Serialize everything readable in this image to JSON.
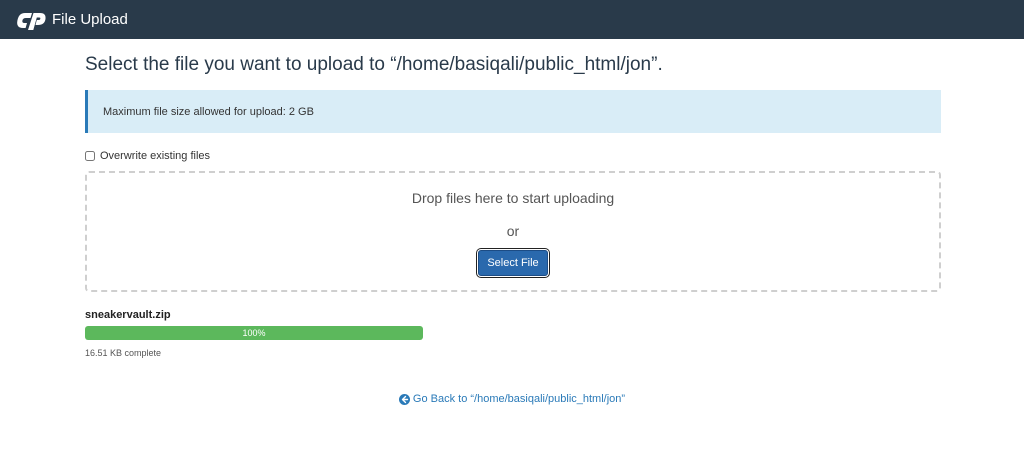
{
  "header": {
    "app_title": "File Upload",
    "logo_name": "cpanel-logo"
  },
  "main": {
    "title": "Select the file you want to upload to “/home/basiqali/public_html/jon”.",
    "info_message": "Maximum file size allowed for upload: 2 GB",
    "overwrite_label": "Overwrite existing files",
    "overwrite_checked": false,
    "dropzone": {
      "drop_text": "Drop files here to start uploading",
      "or_text": "or",
      "select_button_label": "Select File"
    },
    "upload": {
      "file_name": "sneakervault.zip",
      "progress_percent": 100,
      "progress_label": "100%",
      "status_text": "16.51 KB complete"
    },
    "go_back_label": "Go Back to “/home/basiqali/public_html/jon”"
  },
  "colors": {
    "header_bg": "#293a4a",
    "info_bg": "#d9edf7",
    "info_border": "#2a7ab8",
    "button_bg": "#2a69ad",
    "progress_fill": "#5cb85c",
    "link": "#2a7ab8"
  }
}
